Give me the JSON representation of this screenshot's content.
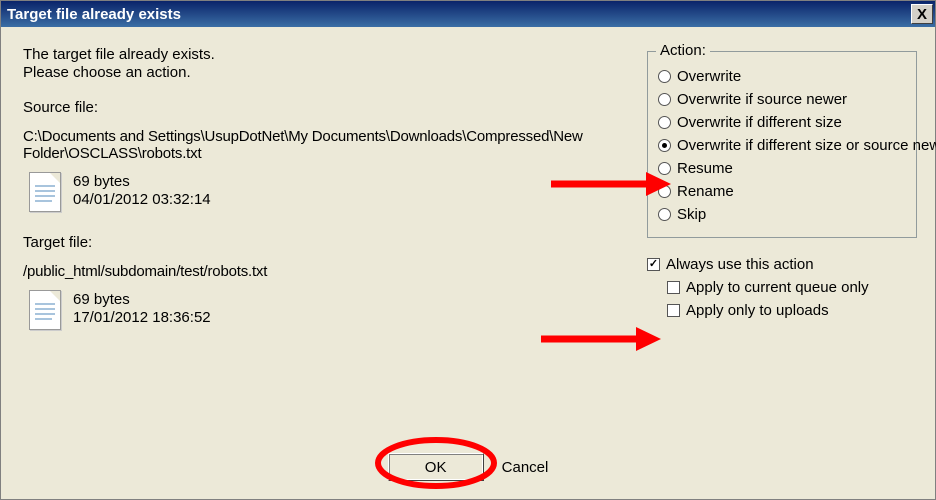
{
  "title": "Target file already exists",
  "close_x": "X",
  "message": {
    "line1": "The target file already exists.",
    "line2": "Please choose an action."
  },
  "source": {
    "label": "Source file:",
    "path": "C:\\Documents and Settings\\UsupDotNet\\My Documents\\Downloads\\Compressed\\New Folder\\OSCLASS\\robots.txt",
    "size": "69 bytes",
    "date": "04/01/2012 03:32:14"
  },
  "target": {
    "label": "Target file:",
    "path": "/public_html/subdomain/test/robots.txt",
    "size": "69 bytes",
    "date": "17/01/2012 18:36:52"
  },
  "action": {
    "legend": "Action:",
    "options": {
      "overwrite": "Overwrite",
      "overwrite_newer": "Overwrite if source newer",
      "overwrite_size": "Overwrite if different size",
      "overwrite_size_or_newer": "Overwrite if different size or source newer",
      "resume": "Resume",
      "rename": "Rename",
      "skip": "Skip"
    },
    "selected": "overwrite_size_or_newer"
  },
  "always": {
    "label": "Always use this action",
    "checked": true,
    "queue_only": "Apply to current queue only",
    "queue_only_checked": false,
    "uploads_only": "Apply only to uploads",
    "uploads_only_checked": false
  },
  "buttons": {
    "ok": "OK",
    "cancel": "Cancel"
  }
}
